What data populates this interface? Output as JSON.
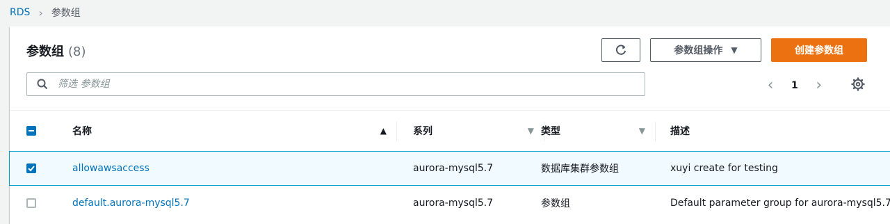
{
  "breadcrumb": {
    "root": "RDS",
    "current": "参数组"
  },
  "header": {
    "title": "参数组",
    "count": "(8)",
    "actions_label": "参数组操作",
    "create_label": "创建参数组"
  },
  "filter": {
    "placeholder": "筛选 参数组",
    "value": ""
  },
  "pagination": {
    "current_page": "1"
  },
  "table": {
    "columns": [
      {
        "label": "名称",
        "sort": "ascending"
      },
      {
        "label": "系列",
        "sort": "descending"
      },
      {
        "label": "类型",
        "sort": "descending"
      },
      {
        "label": "描述",
        "sort": "none"
      }
    ],
    "rows": [
      {
        "selected": true,
        "name": "allowawsaccess",
        "family": "aurora-mysql5.7",
        "type": "数据库集群参数组",
        "description": "xuyi create for testing"
      },
      {
        "selected": false,
        "name": "default.aurora-mysql5.7",
        "family": "aurora-mysql5.7",
        "type": "参数组",
        "description": "Default parameter group for aurora-mysql5.7"
      }
    ]
  },
  "colors": {
    "link": "#0073bb",
    "primary": "#ec7211",
    "selected_row_bg": "#f1faff",
    "selected_row_border": "#00a1c9"
  }
}
